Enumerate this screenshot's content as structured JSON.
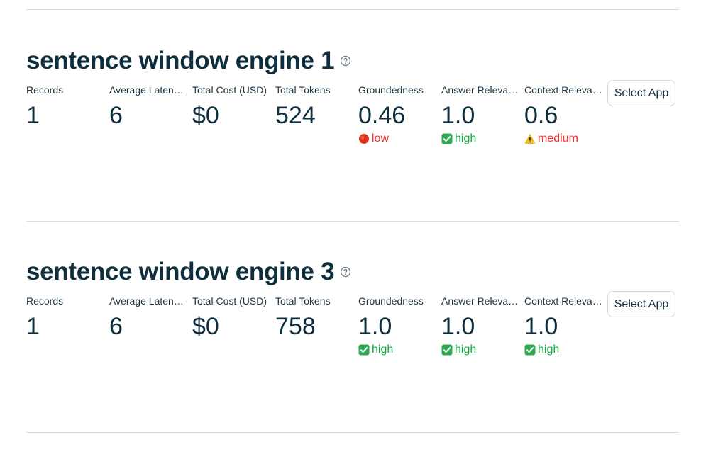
{
  "help_icon": "question-circle-icon",
  "status_icons": {
    "low": "red-circle-icon",
    "high": "green-check-box-icon",
    "medium": "warning-triangle-icon"
  },
  "colors": {
    "low": "#ff2b2b",
    "medium": "#ff2b2b",
    "high": "#09ab3b",
    "text": "#0f2e3d",
    "divider": "#d9dde0"
  },
  "apps": [
    {
      "title": "sentence window engine 1",
      "select_label": "Select App",
      "metrics": [
        {
          "label": "Records",
          "value": "1"
        },
        {
          "label": "Average Laten…",
          "value": "6"
        },
        {
          "label": "Total Cost (USD)",
          "value": "$0"
        },
        {
          "label": "Total Tokens",
          "value": "524"
        },
        {
          "label": "Groundedness",
          "value": "0.46",
          "status": "low"
        },
        {
          "label": "Answer Releva…",
          "value": "1.0",
          "status": "high"
        },
        {
          "label": "Context Releva…",
          "value": "0.6",
          "status": "medium"
        }
      ]
    },
    {
      "title": "sentence window engine 3",
      "select_label": "Select App",
      "metrics": [
        {
          "label": "Records",
          "value": "1"
        },
        {
          "label": "Average Laten…",
          "value": "6"
        },
        {
          "label": "Total Cost (USD)",
          "value": "$0"
        },
        {
          "label": "Total Tokens",
          "value": "758"
        },
        {
          "label": "Groundedness",
          "value": "1.0",
          "status": "high"
        },
        {
          "label": "Answer Releva…",
          "value": "1.0",
          "status": "high"
        },
        {
          "label": "Context Releva…",
          "value": "1.0",
          "status": "high"
        }
      ]
    }
  ]
}
